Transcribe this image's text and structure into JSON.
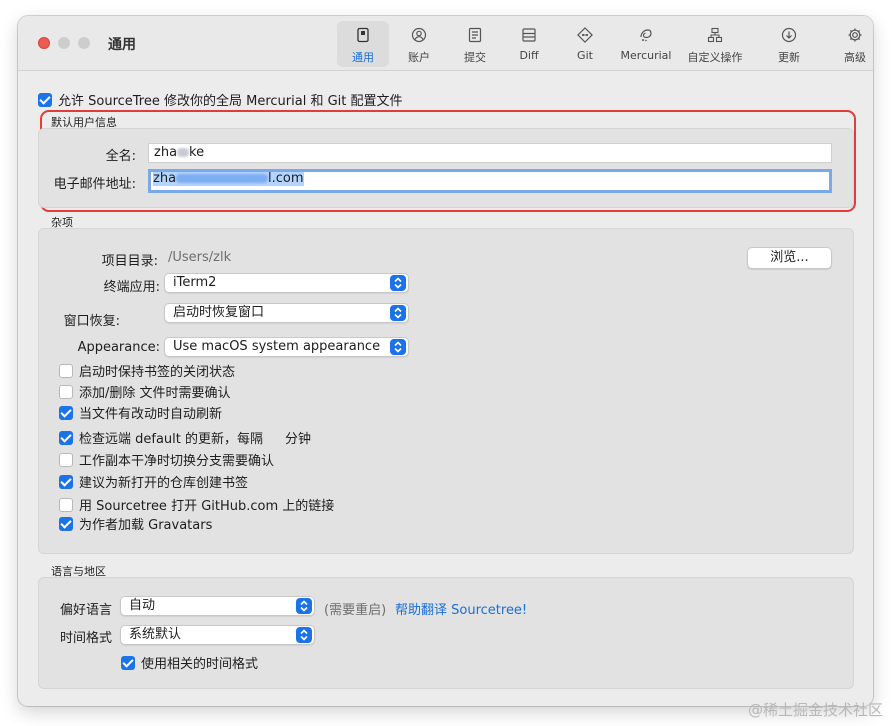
{
  "window": {
    "title": "通用"
  },
  "toolbar": {
    "tabs": [
      {
        "label": "通用",
        "icon": "general-icon",
        "active": true
      },
      {
        "label": "账户",
        "icon": "account-icon"
      },
      {
        "label": "提交",
        "icon": "commit-icon"
      },
      {
        "label": "Diff",
        "icon": "diff-icon"
      },
      {
        "label": "Git",
        "icon": "git-icon"
      },
      {
        "label": "Mercurial",
        "icon": "mercurial-icon"
      },
      {
        "label": "自定义操作",
        "icon": "custom-actions-icon"
      },
      {
        "label": "更新",
        "icon": "update-icon"
      },
      {
        "label": "高级",
        "icon": "gear-icon"
      }
    ]
  },
  "allow_modify": {
    "label": "允许 SourceTree 修改你的全局 Mercurial 和 Git 配置文件",
    "checked": true
  },
  "user_info": {
    "section_title": "默认用户信息",
    "fullname_label": "全名:",
    "fullname_prefix": "zha",
    "fullname_suffix": "ke",
    "email_label": "电子邮件地址:",
    "email_prefix": "zha",
    "email_suffix": "l.com"
  },
  "misc": {
    "section_title": "杂项",
    "project_dir_label": "项目目录:",
    "project_dir_value": "/Users/zlk",
    "browse_button": "浏览...",
    "terminal_label": "终端应用:",
    "terminal_value": "iTerm2",
    "window_restore_label": "窗口恢复:",
    "window_restore_value": "启动时恢复窗口",
    "appearance_label": "Appearance:",
    "appearance_value": "Use macOS system appearance",
    "options": [
      {
        "label": "启动时保持书签的关闭状态",
        "checked": false
      },
      {
        "label": "添加/删除 文件时需要确认",
        "checked": false
      },
      {
        "label": "当文件有改动时自动刷新",
        "checked": true
      },
      {
        "label": "检查远端 default 的更新，每隔",
        "checked": true,
        "suffix": "分钟"
      },
      {
        "label": "工作副本干净时切换分支需要确认",
        "checked": false
      },
      {
        "label": "建议为新打开的仓库创建书签",
        "checked": true
      },
      {
        "label": "用 Sourcetree 打开 GitHub.com 上的链接",
        "checked": false
      },
      {
        "label": "为作者加载 Gravatars",
        "checked": true
      }
    ]
  },
  "locale": {
    "section_title": "语言与地区",
    "language_label": "偏好语言",
    "language_value": "自动",
    "restart_note": "(需要重启)",
    "help_translate": "帮助翻译 Sourcetree!",
    "time_format_label": "时间格式",
    "time_format_value": "系统默认",
    "relative_time": {
      "label": "使用相关的时间格式",
      "checked": true
    }
  },
  "watermark": "@稀土掘金技术社区",
  "colors": {
    "accent": "#1a73e8",
    "highlight_border": "#e23b3b",
    "link": "#1a6fd8"
  }
}
